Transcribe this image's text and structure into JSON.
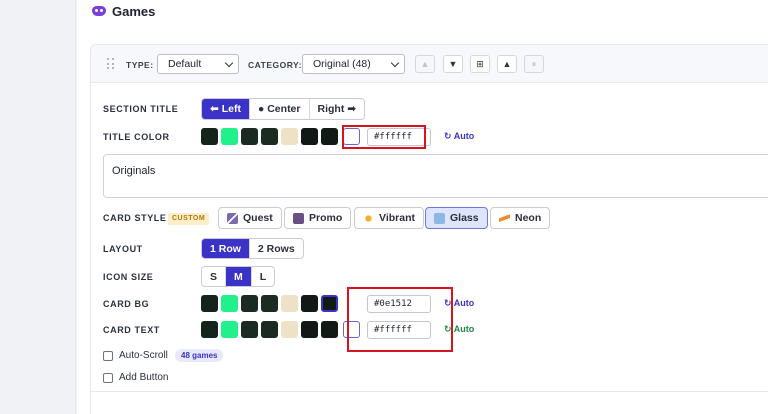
{
  "header": {
    "title": "Games",
    "icon": "gamepad-icon"
  },
  "toolbar": {
    "type_label": "TYPE:",
    "type_value": "Default",
    "category_label": "CATEGORY:",
    "category_value": "Original (48)",
    "buttons": [
      {
        "glyph": "▲",
        "name": "move-up-button",
        "enabled": false
      },
      {
        "glyph": "▼",
        "name": "move-down-button",
        "enabled": true
      },
      {
        "glyph": "⊞",
        "name": "grid-button",
        "enabled": true
      },
      {
        "glyph": "▲",
        "name": "collapse-button",
        "enabled": true
      },
      {
        "glyph": "⏸",
        "name": "pause-button",
        "enabled": false
      }
    ]
  },
  "section_title": {
    "label": "SECTION TITLE",
    "options": [
      "⬅ Left",
      "● Center",
      "Right ➡"
    ],
    "selected": "⬅ Left"
  },
  "title_color": {
    "label": "TITLE COLOR",
    "hex": "#ffffff",
    "auto": "↻ Auto"
  },
  "title_text": "Originals",
  "card_style": {
    "label": "CARD STYLE",
    "badge": "CUSTOM",
    "options": [
      "Quest",
      "Promo",
      "Vibrant",
      "Glass",
      "Neon"
    ],
    "selected": "Glass"
  },
  "layout": {
    "label": "LAYOUT",
    "options": [
      "1 Row",
      "2 Rows"
    ],
    "selected": "1 Row"
  },
  "icon_size": {
    "label": "ICON SIZE",
    "options": [
      "S",
      "M",
      "L"
    ],
    "selected": "M"
  },
  "card_bg": {
    "label": "CARD BG",
    "hex": "#0e1512",
    "auto": "↻ Auto"
  },
  "card_text": {
    "label": "CARD TEXT",
    "hex": "#ffffff",
    "auto": "↻ Auto"
  },
  "auto_scroll": {
    "label": "Auto-Scroll",
    "badge": "48 games",
    "checked": false
  },
  "add_button": {
    "label": "Add Button",
    "checked": false
  },
  "swatch_colors": [
    "#14241b",
    "#22f08a",
    "#1b2a22",
    "#1c2b22",
    "#efe1c6",
    "#111815",
    "#121a16"
  ],
  "colors": {
    "accent": "#3b33c8",
    "highlight": "#d6141f",
    "auto_green": "#1a8a4a"
  }
}
